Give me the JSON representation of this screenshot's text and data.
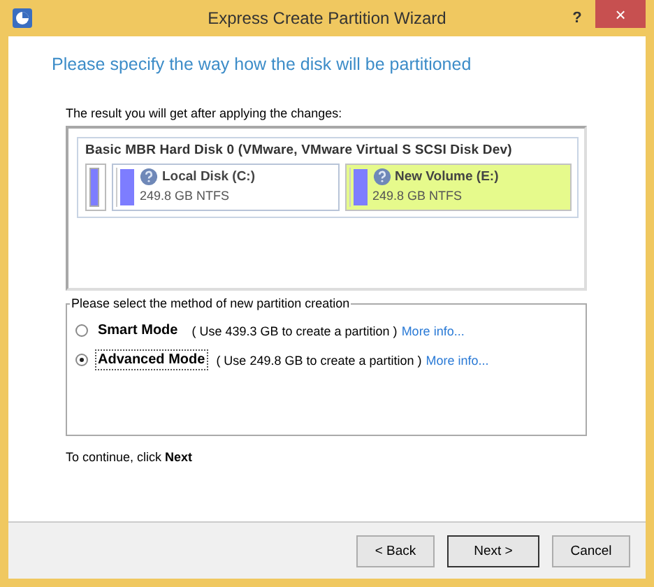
{
  "window": {
    "title": "Express Create Partition Wizard",
    "help": "?",
    "close": "×"
  },
  "heading": "Please specify the way how the disk will be partitioned",
  "result_label": "The result you will get after applying the changes:",
  "disk": {
    "title": "Basic MBR Hard Disk 0 (VMware, VMware Virtual S SCSI Disk Dev)",
    "partitions": [
      {
        "kind": "unallocated",
        "selected": false
      },
      {
        "kind": "partition",
        "name": "Local Disk (C:)",
        "info": "249.8 GB NTFS",
        "selected": false
      },
      {
        "kind": "partition",
        "name": "New Volume (E:)",
        "info": "249.8 GB NTFS",
        "selected": true
      }
    ]
  },
  "method": {
    "legend": "Please select the method of new partition creation",
    "options": [
      {
        "label": "Smart Mode",
        "detail": "( Use 439.3 GB to create a partition )",
        "link": "More info...",
        "selected": false,
        "focused": false
      },
      {
        "label": "Advanced Mode",
        "detail": "( Use 249.8 GB to create a partition )",
        "link": "More info...",
        "selected": true,
        "focused": true
      }
    ]
  },
  "hint": "To continue, click **Next**",
  "buttons": [
    {
      "label": "< Back",
      "default": false
    },
    {
      "label": "Next >",
      "default": true
    },
    {
      "label": "Cancel",
      "default": false
    }
  ]
}
